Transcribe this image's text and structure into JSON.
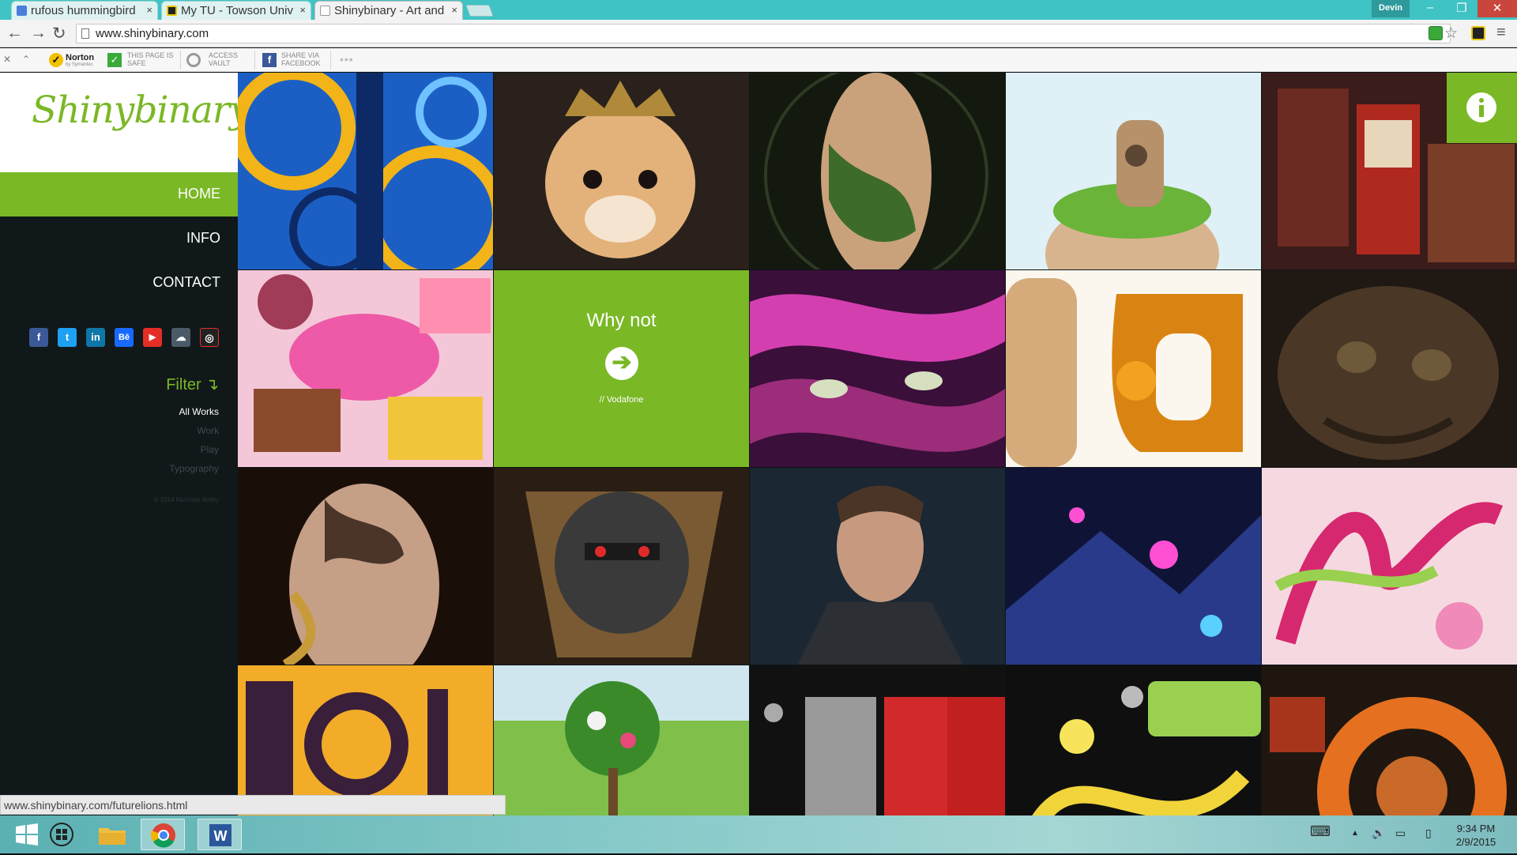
{
  "browser": {
    "tabs": [
      {
        "title": "rufous hummingbird",
        "favicon_color": "#4a7fdb"
      },
      {
        "title": "My TU - Towson Univ",
        "favicon_color": "#222222"
      },
      {
        "title": "Shinybinary - Art and",
        "favicon_color": "#ffffff"
      }
    ],
    "tab_close_glyph": "×",
    "user_name": "Devin",
    "window_buttons": {
      "minimize": "–",
      "maximize": "❐",
      "close": "✕"
    },
    "nav": {
      "back": "←",
      "forward": "→",
      "reload": "↻"
    },
    "url": "www.shinybinary.com",
    "star_glyph": "☆",
    "menu_glyph": "≡",
    "extensions_bar": {
      "close_glyph": "✕",
      "collapse_glyph": "⌃",
      "norton_label": "Norton",
      "norton_sub": "by Symantec",
      "safe_line1": "THIS PAGE IS",
      "safe_line2": "SAFE",
      "vault_line1": "ACCESS",
      "vault_line2": "VAULT",
      "share_line1": "SHARE VIA",
      "share_line2": "FACEBOOK",
      "more_glyph": "•••"
    }
  },
  "site": {
    "logo": "Shinybinary",
    "nav": [
      {
        "label": "HOME",
        "active": true
      },
      {
        "label": "INFO",
        "active": false
      },
      {
        "label": "CONTACT",
        "active": false
      }
    ],
    "social": [
      {
        "icon": "facebook-icon",
        "glyph": "f",
        "color": "#3b5998"
      },
      {
        "icon": "twitter-icon",
        "glyph": "t",
        "color": "#1da1f2"
      },
      {
        "icon": "linkedin-icon",
        "glyph": "in",
        "color": "#0e76a8"
      },
      {
        "icon": "behance-icon",
        "glyph": "Bē",
        "color": "#1769ff"
      },
      {
        "icon": "youtube-icon",
        "glyph": "▶",
        "color": "#e52d27"
      },
      {
        "icon": "cloud-icon",
        "glyph": "☁",
        "color": "#4a5a66"
      },
      {
        "icon": "dribbble-icon",
        "glyph": "◎",
        "color": "#222222"
      }
    ],
    "filter": {
      "title": "Filter",
      "arrow": "↴",
      "items": [
        {
          "label": "All Works",
          "active": true
        },
        {
          "label": "Work",
          "active": false
        },
        {
          "label": "Play",
          "active": false
        },
        {
          "label": "Typography",
          "active": false
        }
      ]
    },
    "copyright": "© 2014 Nicholas Ainley",
    "cta": {
      "title": "Why not",
      "arrow": "➔",
      "subtitle": "// Vodafone"
    },
    "info_glyph": "i",
    "status_url": "www.shinybinary.com/futurelions.html"
  },
  "taskbar": {
    "time": "9:34 PM",
    "date": "2/9/2015",
    "tray": {
      "keyboard": "⌨",
      "up": "▲",
      "speaker": "🔊",
      "monitor": "▭",
      "battery": "▯"
    }
  }
}
